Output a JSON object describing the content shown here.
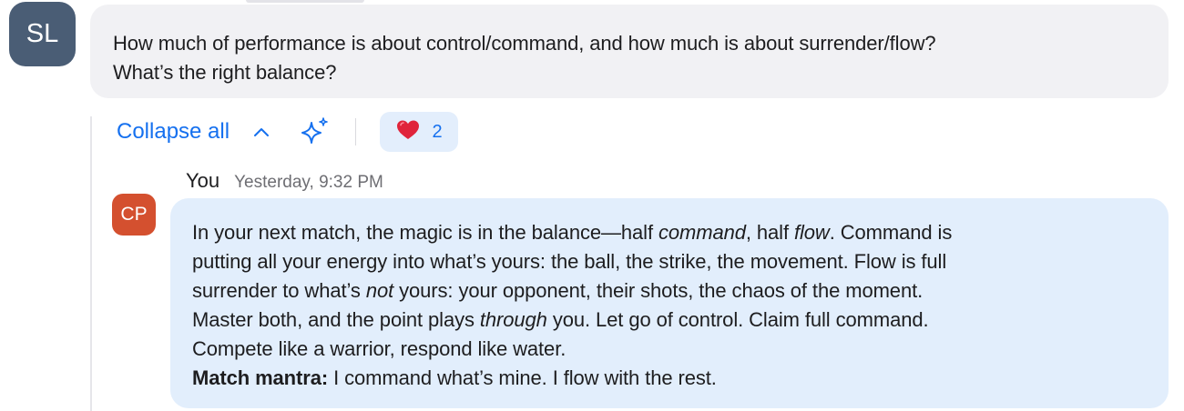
{
  "question": {
    "avatar_initials": "SL",
    "lines": [
      "How much of performance is about control/command, and how much is about surrender/flow?",
      "What’s the right balance?"
    ]
  },
  "thread": {
    "collapse_label": "Collapse all",
    "reaction": {
      "emoji": "❤️",
      "count": "2"
    }
  },
  "reply": {
    "sender": "You",
    "timestamp": "Yesterday, 9:32 PM",
    "avatar_initials": "CP",
    "line1": {
      "a": "In your next match, the magic is in the balance—half ",
      "b": "command",
      "c": ", half ",
      "d": "flow",
      "e": ". Command is"
    },
    "line2": "putting all your energy into what’s yours: the ball, the strike, the movement. Flow is full",
    "line3": {
      "a": "surrender to what’s ",
      "b": "not",
      "c": " yours: your opponent, their shots, the chaos of the moment."
    },
    "line4": {
      "a": "Master both, and the point plays ",
      "b": "through",
      "c": " you. Let go of control. Claim full command."
    },
    "line5": "Compete like a warrior, respond like water.",
    "mantra_label": "Match mantra:",
    "mantra_text": " I command what’s mine. I flow with the rest."
  },
  "colors": {
    "link": "#1570ef",
    "sl_avatar": "#4a5d75",
    "cp_avatar": "#d4502f",
    "question_bubble": "#f1f1f4",
    "answer_bubble": "#e2eefc",
    "reaction_bg": "#e3eefc"
  },
  "icons": [
    "chevron-up-icon",
    "sparkle-icon",
    "heart-emoji"
  ]
}
